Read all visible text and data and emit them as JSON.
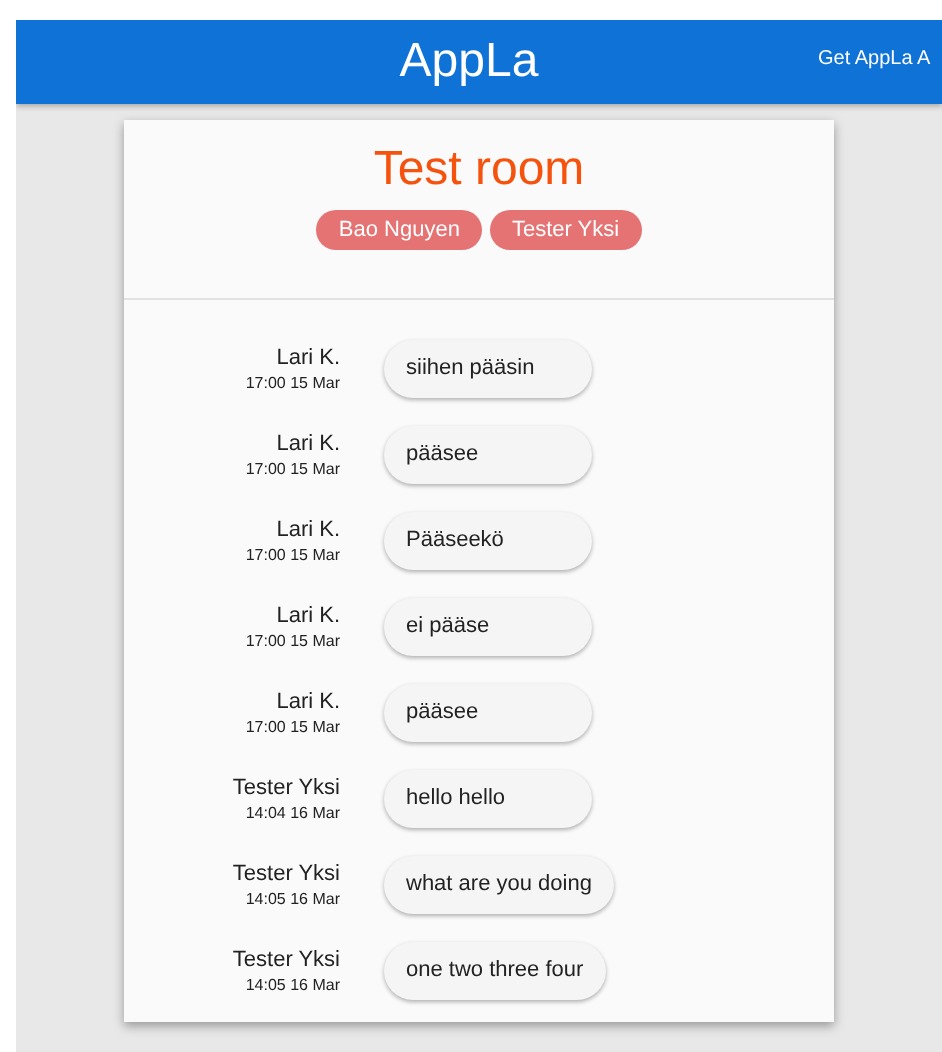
{
  "header": {
    "title": "AppLa",
    "link": "Get AppLa A"
  },
  "room": {
    "title": "Test room",
    "members": [
      "Bao Nguyen",
      "Tester Yksi"
    ]
  },
  "messages": [
    {
      "sender": "Lari K.",
      "time": "17:00 15 Mar",
      "text": "siihen pääsin"
    },
    {
      "sender": "Lari K.",
      "time": "17:00 15 Mar",
      "text": "pääsee"
    },
    {
      "sender": "Lari K.",
      "time": "17:00 15 Mar",
      "text": "Pääseekö"
    },
    {
      "sender": "Lari K.",
      "time": "17:00 15 Mar",
      "text": "ei pääse"
    },
    {
      "sender": "Lari K.",
      "time": "17:00 15 Mar",
      "text": "pääsee"
    },
    {
      "sender": "Tester Yksi",
      "time": "14:04 16 Mar",
      "text": "hello hello"
    },
    {
      "sender": "Tester Yksi",
      "time": "14:05 16 Mar",
      "text": "what are you doing"
    },
    {
      "sender": "Tester Yksi",
      "time": "14:05 16 Mar",
      "text": "one two three four"
    }
  ]
}
